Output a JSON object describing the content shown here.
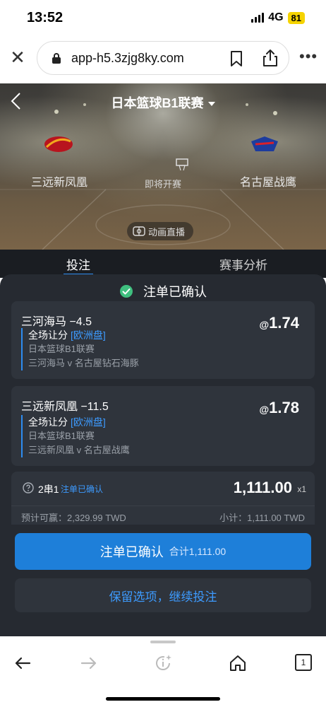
{
  "status_bar": {
    "time": "13:52",
    "network": "4G",
    "battery": "81"
  },
  "browser": {
    "url": "app-h5.3zjg8ky.com"
  },
  "match": {
    "league": "日本篮球B1联赛",
    "home_team": "三远新凤凰",
    "away_team": "名古屋战鹰",
    "status": "即将开赛",
    "animation_button": "动画直播"
  },
  "tabs": [
    {
      "label": "投注"
    },
    {
      "label": "赛事分析"
    }
  ],
  "betslip": {
    "title": "注单已确认",
    "selections": [
      {
        "selection": "三河海马 −4.5",
        "odds_prefix": "@",
        "odds": "1.74",
        "market": "全场让分",
        "market_type": "[欧洲盘]",
        "league": "日本篮球B1联赛",
        "fixture": "三河海马 v 名古屋钻石海豚"
      },
      {
        "selection": "三远新凤凰 −11.5",
        "odds_prefix": "@",
        "odds": "1.78",
        "market": "全场让分",
        "market_type": "[欧洲盘]",
        "league": "日本篮球B1联赛",
        "fixture": "三远新凤凰 v 名古屋战鹰"
      }
    ],
    "summary": {
      "combo": "2串1",
      "combo_status": "注单已确认",
      "stake": "1,111.00",
      "multiplier": "x1",
      "potential_win": "预计可赢：2,329.99 TWD",
      "subtotal": "小计：1,111.00 TWD"
    },
    "primary_button": {
      "label": "注单已确认",
      "total": "合计1,111.00"
    },
    "secondary_button": {
      "label": "保留选项，继续投注"
    }
  },
  "toolbar": {
    "tab_count": "1"
  },
  "colors": {
    "accent": "#1e7fd9",
    "link": "#3d9bff",
    "sheet": "#262a31",
    "card": "#2f343c",
    "success": "#3fbf7f"
  }
}
